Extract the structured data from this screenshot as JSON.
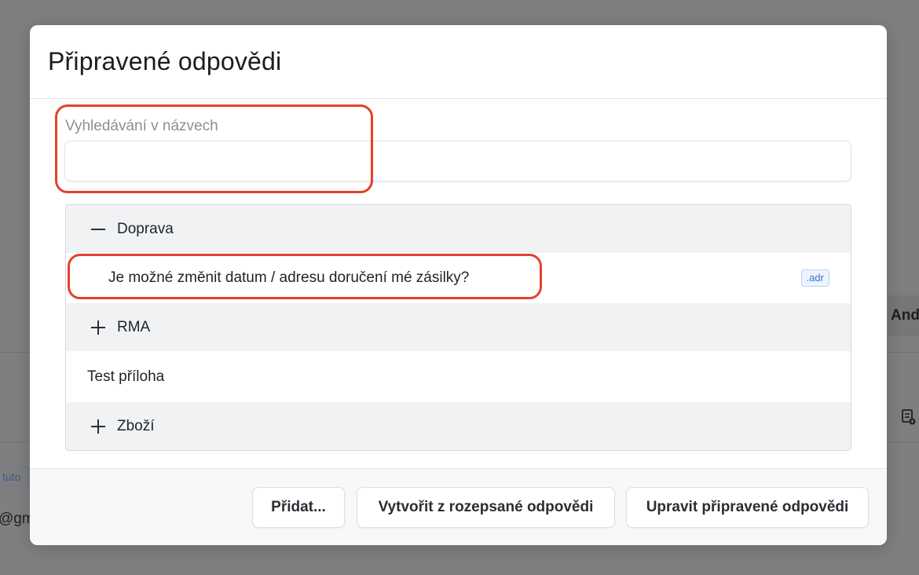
{
  "background": {
    "right_fragment": "And",
    "tag_fragment": "tuto",
    "email_fragment": "@gm"
  },
  "modal": {
    "title": "Připravené odpovědi",
    "search": {
      "label": "Vyhledávání v názvech",
      "value": ""
    },
    "list": {
      "groups": [
        {
          "label": "Doprava",
          "expanded": true
        },
        {
          "label": "RMA",
          "expanded": false
        },
        {
          "label": "Zboží",
          "expanded": false
        }
      ],
      "doprava_item": {
        "label": "Je možné změnit datum / adresu doručení mé zásilky?",
        "badge": ".adr"
      },
      "standalone_item": {
        "label": "Test příloha"
      }
    },
    "footer": {
      "add_label": "Přidat...",
      "create_label": "Vytvořit z rozepsané odpovědi",
      "edit_label": "Upravit připravené odpovědi"
    }
  },
  "colors": {
    "highlight": "#e4412a",
    "badge_text": "#3b6fd0",
    "overlay": "#7f7f7f"
  }
}
